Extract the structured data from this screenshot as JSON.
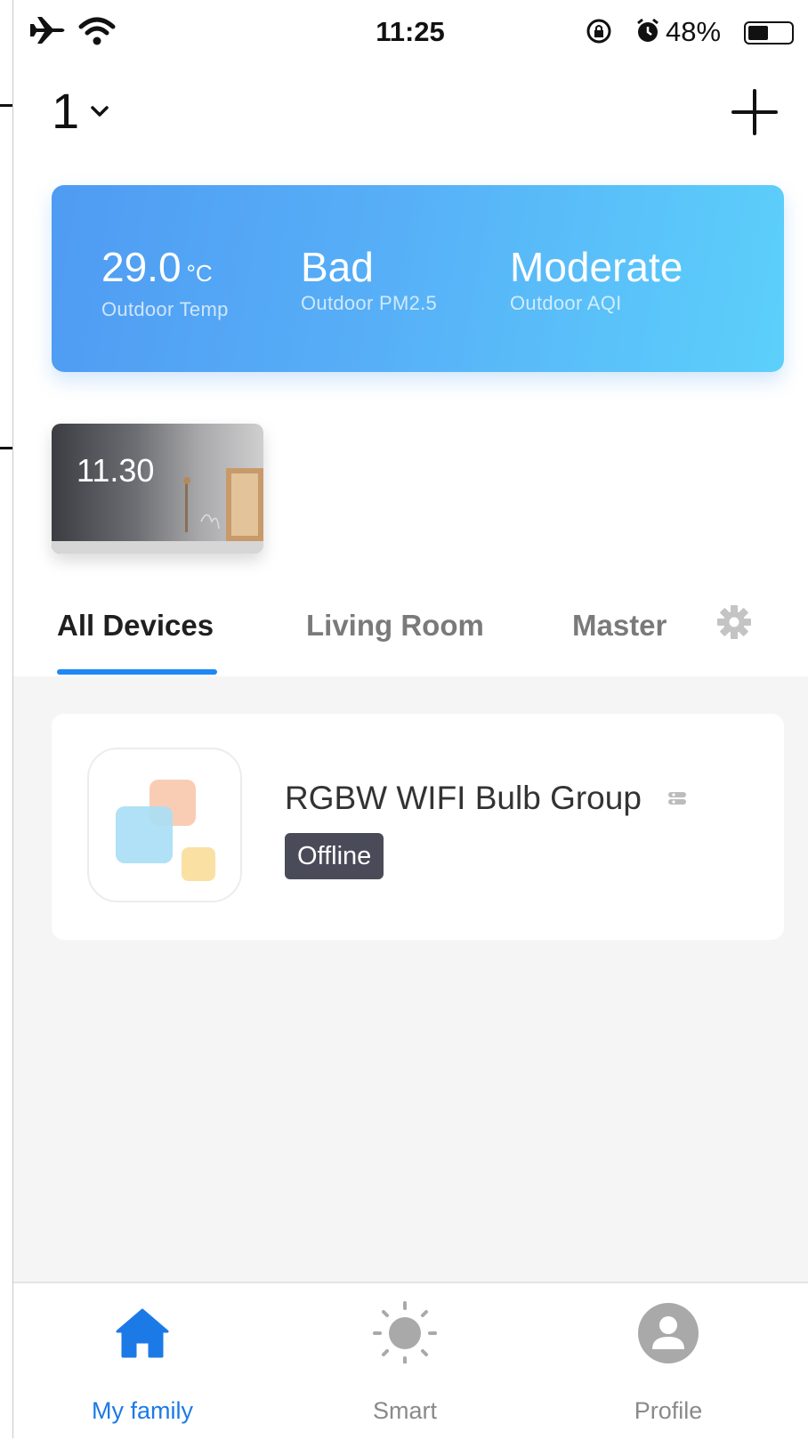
{
  "status_bar": {
    "time": "11:25",
    "battery_text": "48%",
    "battery_level": 0.48
  },
  "header": {
    "home_name": "1"
  },
  "weather": {
    "temp_value": "29.0",
    "temp_unit": "°C",
    "temp_label": "Outdoor Temp",
    "pm_value": "Bad",
    "pm_label": "Outdoor PM2.5",
    "aqi_value": "Moderate",
    "aqi_label": "Outdoor AQI"
  },
  "scene": {
    "label": "11.30"
  },
  "tabs": [
    {
      "label": "All Devices",
      "active": true
    },
    {
      "label": "Living Room",
      "active": false
    },
    {
      "label": "Master",
      "active": false
    }
  ],
  "devices": [
    {
      "name": "RGBW WIFI Bulb Group",
      "status": "Offline"
    }
  ],
  "bottom_nav": [
    {
      "label": "My family",
      "icon": "home-icon",
      "active": true
    },
    {
      "label": "Smart",
      "icon": "sun-icon",
      "active": false
    },
    {
      "label": "Profile",
      "icon": "profile-icon",
      "active": false
    }
  ],
  "colors": {
    "accent": "#1e88f5",
    "weather_gradient_start": "#4f9bf3",
    "weather_gradient_end": "#5cd0fb",
    "offline_badge": "#4a4b58"
  }
}
